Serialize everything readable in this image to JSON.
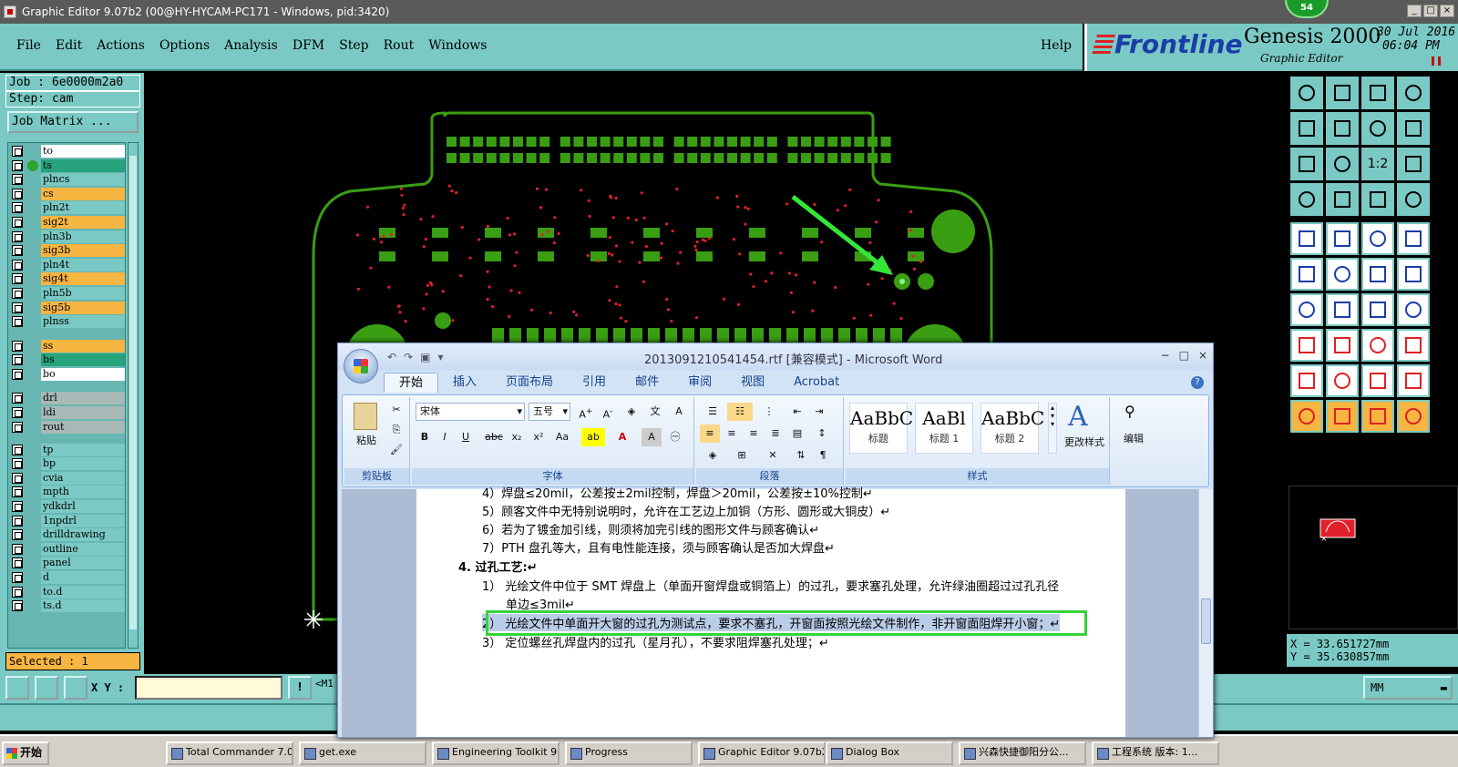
{
  "titlebar": {
    "title": "Graphic Editor 9.07b2 (00@HY-HYCAM-PC171 - Windows, pid:3420)",
    "badge": "54"
  },
  "menu": {
    "items": [
      "File",
      "Edit",
      "Actions",
      "Options",
      "Analysis",
      "DFM",
      "Step",
      "Rout",
      "Windows"
    ],
    "help": "Help"
  },
  "brand": {
    "logo": "Frontline",
    "product": "Genesis 2000",
    "subtitle": "Graphic Editor",
    "date": "30 Jul 2016",
    "time": "06:04 PM"
  },
  "left": {
    "job": "Job : 6e0000m2a0",
    "step": "Step: cam",
    "job_matrix": "Job Matrix ...",
    "selected": "Selected : 1",
    "layers": [
      {
        "name": "to",
        "color": "#ffffff"
      },
      {
        "name": "ts",
        "color": "#26a37d",
        "dot": true
      },
      {
        "name": "plncs",
        "color": "#7ac9c4"
      },
      {
        "name": "cs",
        "color": "#f7b542"
      },
      {
        "name": "pln2t",
        "color": "#7ac9c4"
      },
      {
        "name": "sig2t",
        "color": "#f7b542"
      },
      {
        "name": "pln3b",
        "color": "#7ac9c4"
      },
      {
        "name": "sig3b",
        "color": "#f7b542"
      },
      {
        "name": "pln4t",
        "color": "#7ac9c4"
      },
      {
        "name": "sig4t",
        "color": "#f7b542"
      },
      {
        "name": "pln5b",
        "color": "#7ac9c4"
      },
      {
        "name": "sig5b",
        "color": "#f7b542"
      },
      {
        "name": "plnss",
        "color": "#7ac9c4"
      },
      {
        "name": "ss",
        "color": "#f7b542"
      },
      {
        "name": "bs",
        "color": "#26a37d"
      },
      {
        "name": "bo",
        "color": "#ffffff"
      },
      {
        "name": "drl",
        "color": "#a8b8b6"
      },
      {
        "name": "ldi",
        "color": "#a8b8b6"
      },
      {
        "name": "rout",
        "color": "#a8b8b6"
      },
      {
        "name": "tp",
        "color": "#7ac9c4"
      },
      {
        "name": "bp",
        "color": "#7ac9c4"
      },
      {
        "name": "cvia",
        "color": "#7ac9c4"
      },
      {
        "name": "mpth",
        "color": "#7ac9c4"
      },
      {
        "name": "ydkdrl",
        "color": "#7ac9c4"
      },
      {
        "name": "1npdrl",
        "color": "#7ac9c4"
      },
      {
        "name": "drilldrawing",
        "color": "#7ac9c4"
      },
      {
        "name": "outline",
        "color": "#7ac9c4"
      },
      {
        "name": "panel",
        "color": "#7ac9c4"
      },
      {
        "name": "d",
        "color": "#7ac9c4"
      },
      {
        "name": "to.d",
        "color": "#7ac9c4"
      },
      {
        "name": "ts.d",
        "color": "#7ac9c4"
      }
    ]
  },
  "right": {
    "x": "X = 33.651727mm",
    "y": "Y = 35.630857mm",
    "toolbar_icon_glyph": "1:2"
  },
  "bottom": {
    "xy_label": "X Y :",
    "msg": "<M1",
    "units": "MM"
  },
  "taskbar": {
    "start": "开始",
    "tasks": [
      "Total Commander 7.0 ...",
      "get.exe",
      "Engineering Toolkit 9....",
      "Progress",
      "Graphic Editor 9.07b2...",
      "Dialog Box",
      "兴森快捷御阳分公...",
      "工程系统  版本: 1..."
    ]
  },
  "word": {
    "title": "2013091210541454.rtf [兼容模式] - Microsoft Word",
    "tabs": [
      "开始",
      "插入",
      "页面布局",
      "引用",
      "邮件",
      "审阅",
      "视图",
      "Acrobat"
    ],
    "groups": {
      "clipboard": "剪贴板",
      "font": "字体",
      "paragraph": "段落",
      "styles": "样式"
    },
    "paste": "粘贴",
    "font_name": "宋体",
    "font_size": "五号",
    "styles": [
      {
        "sample": "AaBbC",
        "name": "标题"
      },
      {
        "sample": "AaBl",
        "name": "标题 1"
      },
      {
        "sample": "AaBbC",
        "name": "标题 2"
      }
    ],
    "change_styles": "更改样式",
    "edit": "编辑",
    "lines": [
      "4）焊盘≤20mil，公差按±2mil控制，焊盘＞20mil，公差按±10%控制↵",
      "5）顾客文件中无特别说明时，允许在工艺边上加铜（方形、圆形或大铜皮）↵",
      "6）若为了镀金加引线，则须将加完引线的图形文件与顾客确认↵",
      "7）PTH 盘孔等大，且有电性能连接，须与顾客确认是否加大焊盘↵",
      "4.   过孔工艺:↵",
      "1）  光绘文件中位于 SMT 焊盘上（单面开窗焊盘或铜箔上）的过孔，要求塞孔处理，允许绿油圈超过过孔孔径",
      "单边≤3mil↵",
      "2）  光绘文件中单面开大窗的过孔为测试点，要求不塞孔，开窗面按照光绘文件制作，非开窗面阻焊开小窗；↵",
      "3）  定位螺丝孔焊盘内的过孔（星月孔），不要求阻焊塞孔处理；↵"
    ]
  }
}
